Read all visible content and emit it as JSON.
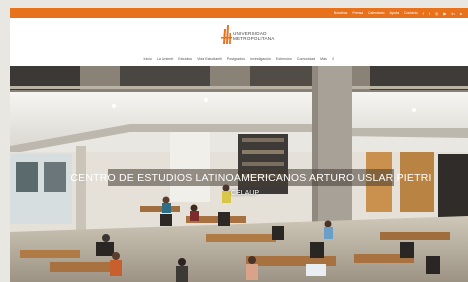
{
  "topbar": {
    "links": [
      "Nosotros",
      "Prensa",
      "Calendario",
      "Ayuda",
      "Contacto"
    ],
    "social_icons": [
      "facebook-icon",
      "twitter-icon",
      "instagram-icon",
      "youtube-icon",
      "linkedin-icon",
      "flickr-icon"
    ]
  },
  "brand": {
    "line1": "UNIVERSIDAD",
    "line2": "METROPOLITANA",
    "accent": "#e8711c"
  },
  "nav": {
    "items": [
      "Inicio",
      "La Unimet",
      "Estudios",
      "Vida Estudiantil",
      "Postgrados",
      "Investigación",
      "Extensión",
      "Comunidad",
      "Más"
    ],
    "search_icon": "search-icon"
  },
  "hero": {
    "title": "CENTRO DE ESTUDIOS LATINOAMERICANOS ARTURO USLAR PIETRI",
    "subtitle": "CELAUP"
  }
}
